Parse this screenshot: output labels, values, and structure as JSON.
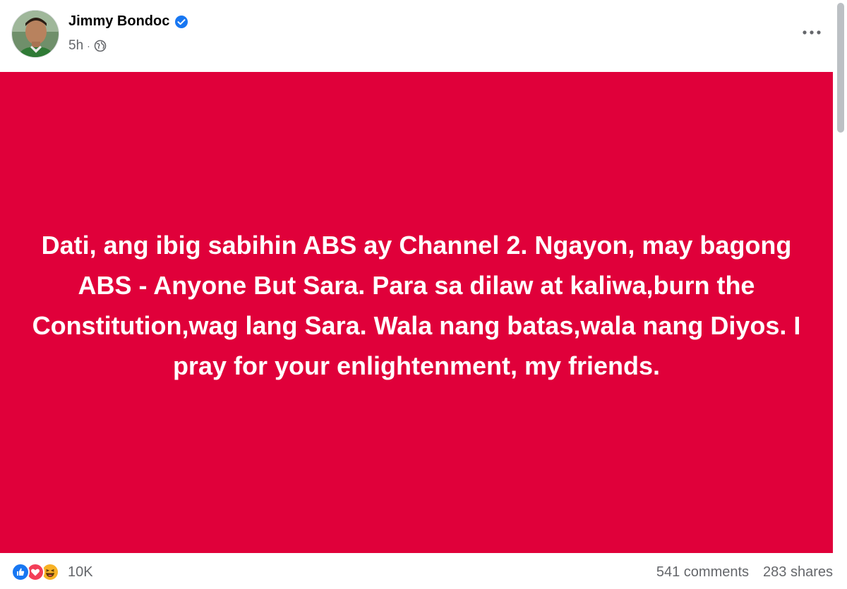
{
  "author": {
    "name": "Jimmy Bondoc",
    "verified": true,
    "time": "5h",
    "separator": "·",
    "audience_icon": "globe-icon"
  },
  "post": {
    "text": "Dati, ang ibig sabihin ABS ay Channel 2. Ngayon, may bagong ABS - Anyone But Sara. Para sa dilaw at kaliwa,burn the Constitution,wag lang Sara. Wala nang batas,wala nang Diyos. I pray for your enlightenment, my friends.",
    "background_color": "#e0003a",
    "text_color": "#ffffff"
  },
  "reactions": {
    "types": [
      "like-icon",
      "love-icon",
      "haha-icon"
    ],
    "count": "10K"
  },
  "stats": {
    "comments": "541 comments",
    "shares": "283 shares"
  },
  "colors": {
    "like": "#1877f2",
    "love": "#f33e58",
    "haha": "#f7b125",
    "verified": "#1877f2"
  }
}
